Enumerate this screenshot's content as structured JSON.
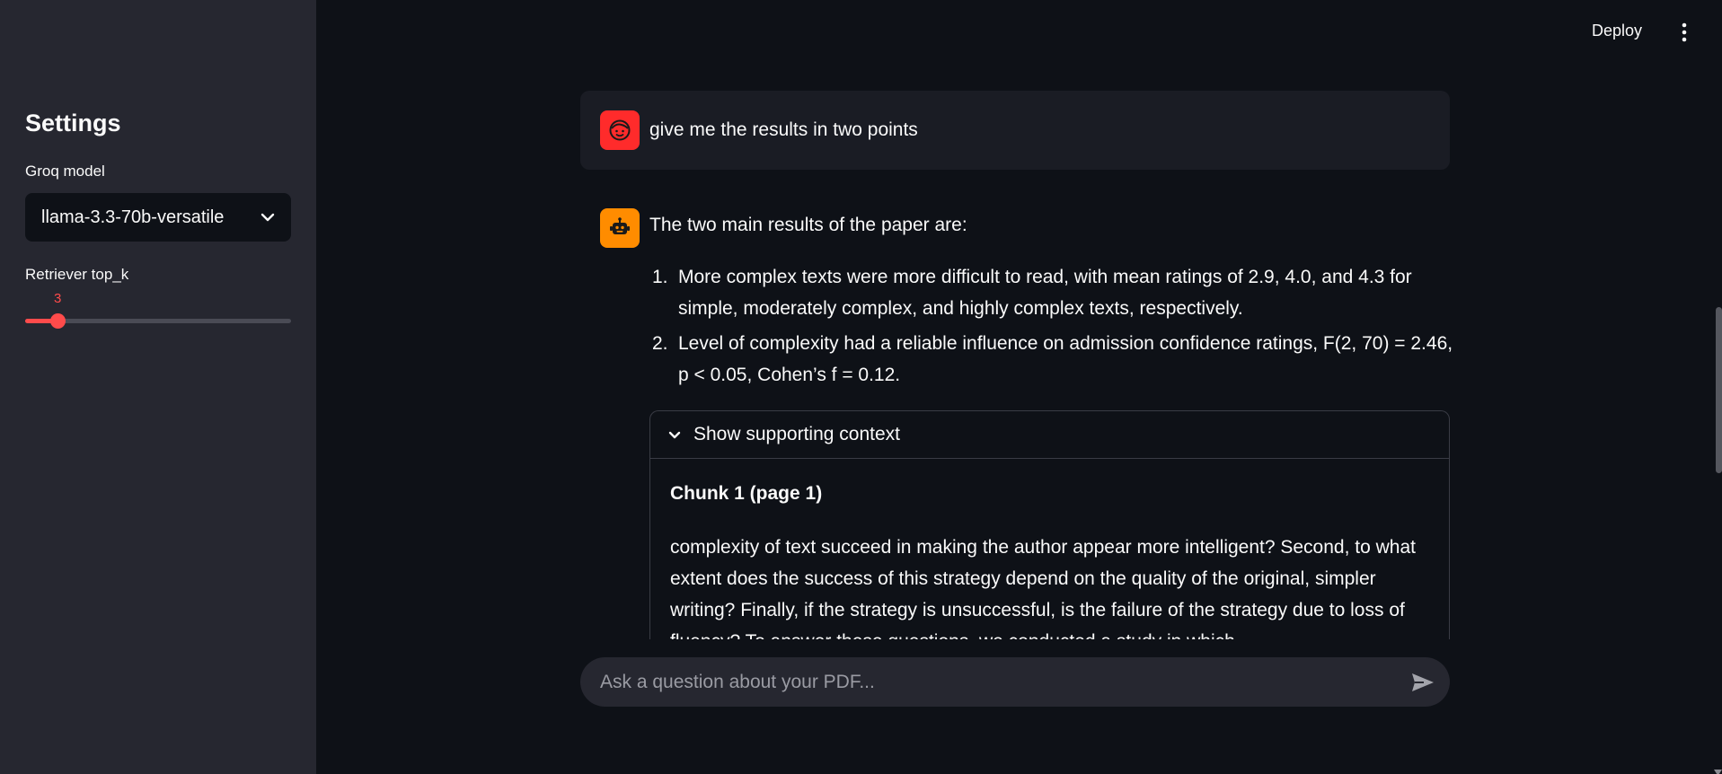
{
  "sidebar": {
    "title": "Settings",
    "model_label": "Groq model",
    "model_value": "llama-3.3-70b-versatile",
    "topk_label": "Retriever top_k",
    "topk_value": "3"
  },
  "header": {
    "deploy_label": "Deploy"
  },
  "chat": {
    "user_message": "give me the results in two points",
    "assistant_intro": "The two main results of the paper are:",
    "assistant_points": [
      {
        "num": "1.",
        "text": "More complex texts were more difficult to read, with mean ratings of 2.9, 4.0, and 4.3 for simple, moderately complex, and highly complex texts, respectively."
      },
      {
        "num": "2.",
        "text": "Level of complexity had a reliable influence on admission confidence ratings, F(2, 70) = 2.46, p < 0.05, Cohen’s f = 0.12."
      }
    ],
    "context": {
      "expander_label": "Show supporting context",
      "chunk_title": "Chunk 1 (page 1)",
      "chunk_text": "complexity of text succeed in making the author appear more intelligent? Second, to what extent does the success of this strategy depend on the quality of the original, simpler writing? Finally, if the strategy is unsuccessful, is the failure of the strategy due to loss of fluency? To answer these questions, we conducted a study in which..."
    }
  },
  "input": {
    "placeholder": "Ask a question about your PDF..."
  },
  "colors": {
    "accent": "#ff4b4b",
    "user_avatar": "#ff2b2b",
    "bot_avatar": "#ff8c00",
    "sidebar_bg": "#262730",
    "main_bg": "#0e1117"
  },
  "icons": {
    "user_avatar": "face-icon",
    "bot_avatar": "robot-icon",
    "menu": "kebab-menu-icon",
    "send": "send-icon"
  }
}
